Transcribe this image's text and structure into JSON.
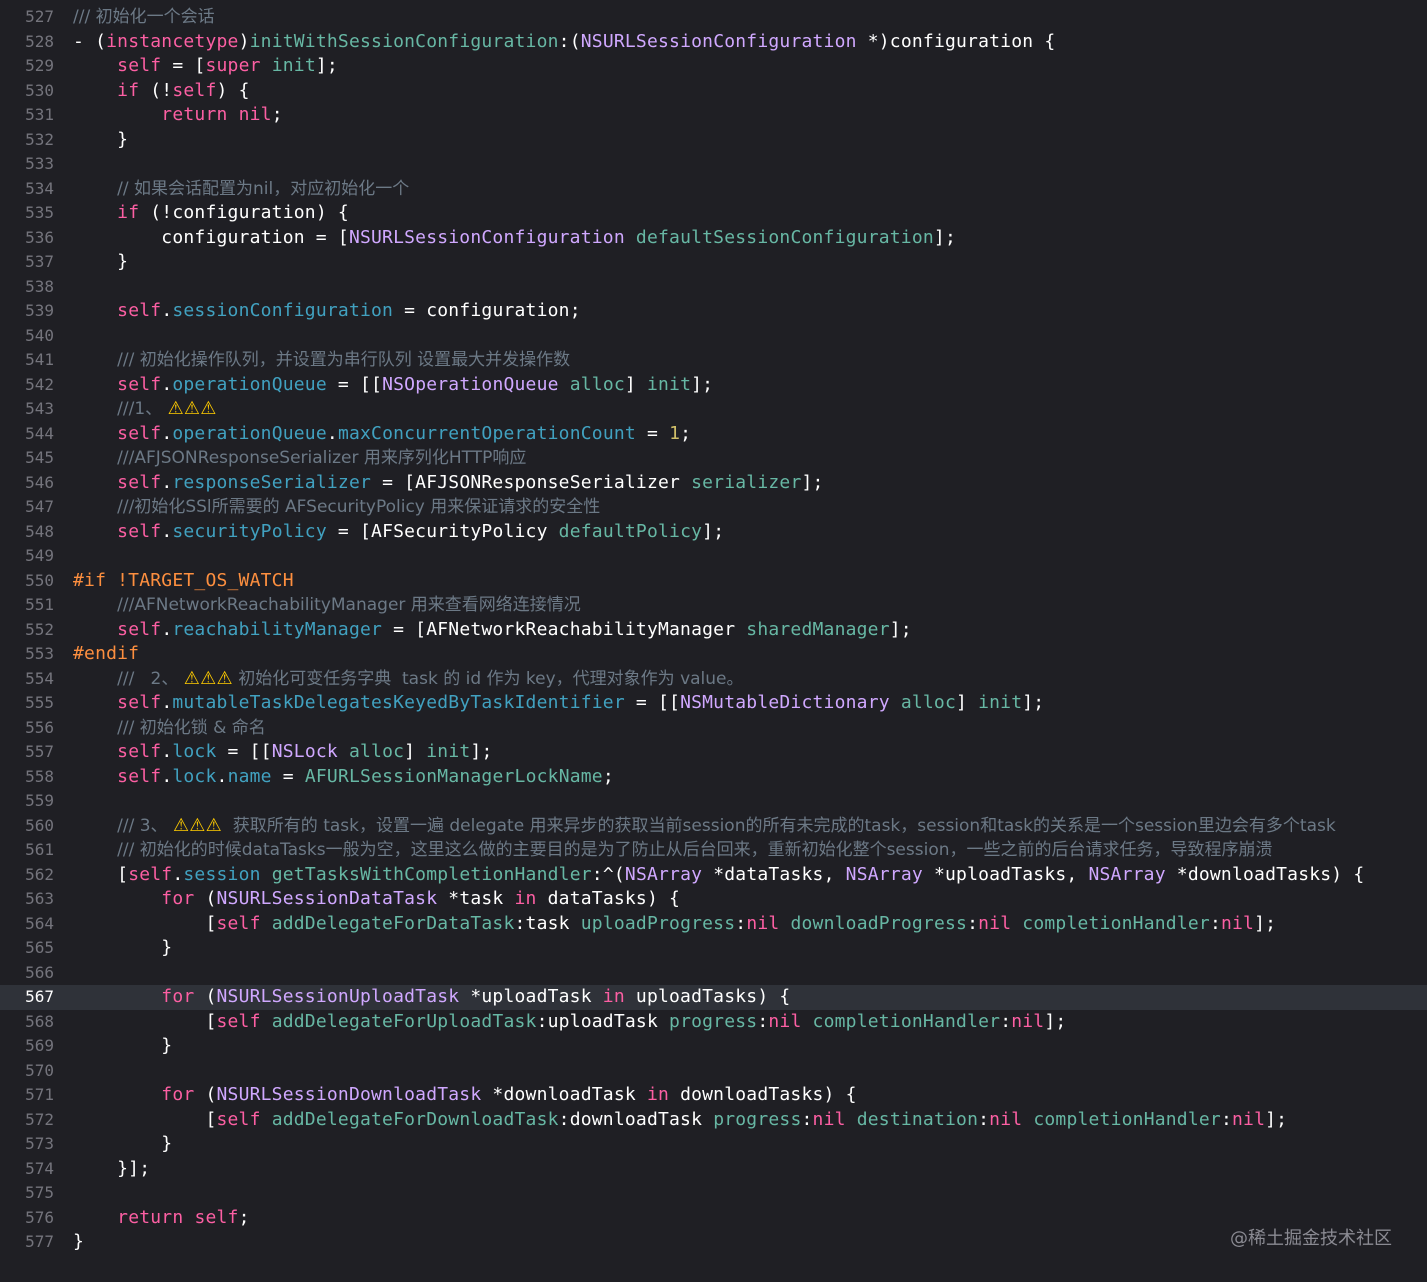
{
  "editor": {
    "current_line": 567,
    "lines": [
      {
        "n": 527,
        "t": [
          [
            "c",
            "/// 初始化一个会话"
          ]
        ]
      },
      {
        "n": 528,
        "t": [
          [
            "p",
            "- ("
          ],
          [
            "k",
            "instancetype"
          ],
          [
            "p",
            ")"
          ],
          [
            "m",
            "initWithSessionConfiguration"
          ],
          [
            "p",
            ":("
          ],
          [
            "t",
            "NSURLSessionConfiguration"
          ],
          [
            "p",
            " *)configuration {"
          ]
        ]
      },
      {
        "n": 529,
        "t": [
          [
            "p",
            "    "
          ],
          [
            "k",
            "self"
          ],
          [
            "p",
            " = ["
          ],
          [
            "k",
            "super"
          ],
          [
            "p",
            " "
          ],
          [
            "m",
            "init"
          ],
          [
            "p",
            "];"
          ]
        ]
      },
      {
        "n": 530,
        "t": [
          [
            "p",
            "    "
          ],
          [
            "k",
            "if"
          ],
          [
            "p",
            " (!"
          ],
          [
            "k",
            "self"
          ],
          [
            "p",
            ") {"
          ]
        ]
      },
      {
        "n": 531,
        "t": [
          [
            "p",
            "        "
          ],
          [
            "k",
            "return"
          ],
          [
            "p",
            " "
          ],
          [
            "k",
            "nil"
          ],
          [
            "p",
            ";"
          ]
        ]
      },
      {
        "n": 532,
        "t": [
          [
            "p",
            "    }"
          ]
        ]
      },
      {
        "n": 533,
        "t": []
      },
      {
        "n": 534,
        "t": [
          [
            "p",
            "    "
          ],
          [
            "c",
            "// 如果会话配置为nil，对应初始化一个"
          ]
        ]
      },
      {
        "n": 535,
        "t": [
          [
            "p",
            "    "
          ],
          [
            "k",
            "if"
          ],
          [
            "p",
            " (!configuration) {"
          ]
        ]
      },
      {
        "n": 536,
        "t": [
          [
            "p",
            "        configuration = ["
          ],
          [
            "t",
            "NSURLSessionConfiguration"
          ],
          [
            "p",
            " "
          ],
          [
            "m",
            "defaultSessionConfiguration"
          ],
          [
            "p",
            "];"
          ]
        ]
      },
      {
        "n": 537,
        "t": [
          [
            "p",
            "    }"
          ]
        ]
      },
      {
        "n": 538,
        "t": []
      },
      {
        "n": 539,
        "t": [
          [
            "p",
            "    "
          ],
          [
            "k",
            "self"
          ],
          [
            "p",
            "."
          ],
          [
            "r",
            "sessionConfiguration"
          ],
          [
            "p",
            " = configuration;"
          ]
        ]
      },
      {
        "n": 540,
        "t": []
      },
      {
        "n": 541,
        "t": [
          [
            "p",
            "    "
          ],
          [
            "c",
            "/// 初始化操作队列，并设置为串行队列 设置最大并发操作数"
          ]
        ]
      },
      {
        "n": 542,
        "t": [
          [
            "p",
            "    "
          ],
          [
            "k",
            "self"
          ],
          [
            "p",
            "."
          ],
          [
            "r",
            "operationQueue"
          ],
          [
            "p",
            " = [["
          ],
          [
            "t",
            "NSOperationQueue"
          ],
          [
            "p",
            " "
          ],
          [
            "m",
            "alloc"
          ],
          [
            "p",
            "] "
          ],
          [
            "m",
            "init"
          ],
          [
            "p",
            "];"
          ]
        ]
      },
      {
        "n": 543,
        "t": [
          [
            "p",
            "    "
          ],
          [
            "c",
            "///1、 "
          ],
          [
            "w",
            "⚠⚠⚠"
          ]
        ]
      },
      {
        "n": 544,
        "t": [
          [
            "p",
            "    "
          ],
          [
            "k",
            "self"
          ],
          [
            "p",
            "."
          ],
          [
            "r",
            "operationQueue"
          ],
          [
            "p",
            "."
          ],
          [
            "r",
            "maxConcurrentOperationCount"
          ],
          [
            "p",
            " = "
          ],
          [
            "n",
            "1"
          ],
          [
            "p",
            ";"
          ]
        ]
      },
      {
        "n": 545,
        "t": [
          [
            "p",
            "    "
          ],
          [
            "c",
            "///AFJSONResponseSerializer 用来序列化HTTP响应"
          ]
        ]
      },
      {
        "n": 546,
        "t": [
          [
            "p",
            "    "
          ],
          [
            "k",
            "self"
          ],
          [
            "p",
            "."
          ],
          [
            "r",
            "responseSerializer"
          ],
          [
            "p",
            " = [AFJSONResponseSerializer "
          ],
          [
            "m",
            "serializer"
          ],
          [
            "p",
            "];"
          ]
        ]
      },
      {
        "n": 547,
        "t": [
          [
            "p",
            "    "
          ],
          [
            "c",
            "///初始化SSl所需要的 AFSecurityPolicy 用来保证请求的安全性"
          ]
        ]
      },
      {
        "n": 548,
        "t": [
          [
            "p",
            "    "
          ],
          [
            "k",
            "self"
          ],
          [
            "p",
            "."
          ],
          [
            "r",
            "securityPolicy"
          ],
          [
            "p",
            " = [AFSecurityPolicy "
          ],
          [
            "m",
            "defaultPolicy"
          ],
          [
            "p",
            "];"
          ]
        ]
      },
      {
        "n": 549,
        "t": []
      },
      {
        "n": 550,
        "t": [
          [
            "x",
            "#if !TARGET_OS_WATCH"
          ]
        ]
      },
      {
        "n": 551,
        "t": [
          [
            "p",
            "    "
          ],
          [
            "c",
            "///AFNetworkReachabilityManager 用来查看网络连接情况"
          ]
        ]
      },
      {
        "n": 552,
        "t": [
          [
            "p",
            "    "
          ],
          [
            "k",
            "self"
          ],
          [
            "p",
            "."
          ],
          [
            "r",
            "reachabilityManager"
          ],
          [
            "p",
            " = [AFNetworkReachabilityManager "
          ],
          [
            "m",
            "sharedManager"
          ],
          [
            "p",
            "];"
          ]
        ]
      },
      {
        "n": 553,
        "t": [
          [
            "x",
            "#endif"
          ]
        ]
      },
      {
        "n": 554,
        "t": [
          [
            "p",
            "    "
          ],
          [
            "c",
            "///   2、 "
          ],
          [
            "w",
            "⚠⚠⚠"
          ],
          [
            "c",
            " 初始化可变任务字典  task 的 id 作为 key，代理对象作为 value。"
          ]
        ]
      },
      {
        "n": 555,
        "t": [
          [
            "p",
            "    "
          ],
          [
            "k",
            "self"
          ],
          [
            "p",
            "."
          ],
          [
            "r",
            "mutableTaskDelegatesKeyedByTaskIdentifier"
          ],
          [
            "p",
            " = [["
          ],
          [
            "t",
            "NSMutableDictionary"
          ],
          [
            "p",
            " "
          ],
          [
            "m",
            "alloc"
          ],
          [
            "p",
            "] "
          ],
          [
            "m",
            "init"
          ],
          [
            "p",
            "];"
          ]
        ]
      },
      {
        "n": 556,
        "t": [
          [
            "p",
            "    "
          ],
          [
            "c",
            "/// 初始化锁 & 命名"
          ]
        ]
      },
      {
        "n": 557,
        "t": [
          [
            "p",
            "    "
          ],
          [
            "k",
            "self"
          ],
          [
            "p",
            "."
          ],
          [
            "r",
            "lock"
          ],
          [
            "p",
            " = [["
          ],
          [
            "t",
            "NSLock"
          ],
          [
            "p",
            " "
          ],
          [
            "m",
            "alloc"
          ],
          [
            "p",
            "] "
          ],
          [
            "m",
            "init"
          ],
          [
            "p",
            "];"
          ]
        ]
      },
      {
        "n": 558,
        "t": [
          [
            "p",
            "    "
          ],
          [
            "k",
            "self"
          ],
          [
            "p",
            "."
          ],
          [
            "r",
            "lock"
          ],
          [
            "p",
            "."
          ],
          [
            "r",
            "name"
          ],
          [
            "p",
            " = "
          ],
          [
            "m",
            "AFURLSessionManagerLockName"
          ],
          [
            "p",
            ";"
          ]
        ]
      },
      {
        "n": 559,
        "t": []
      },
      {
        "n": 560,
        "t": [
          [
            "p",
            "    "
          ],
          [
            "c",
            "/// 3、 "
          ],
          [
            "w",
            "⚠⚠⚠"
          ],
          [
            "c",
            "  获取所有的 task，设置一遍 delegate 用来异步的获取当前session的所有未完成的task，session和task的关系是一个session里边会有多个task"
          ]
        ]
      },
      {
        "n": 561,
        "t": [
          [
            "p",
            "    "
          ],
          [
            "c",
            "/// 初始化的时候dataTasks一般为空，这里这么做的主要目的是为了防止从后台回来，重新初始化整个session，一些之前的后台请求任务，导致程序崩溃"
          ]
        ]
      },
      {
        "n": 562,
        "t": [
          [
            "p",
            "    ["
          ],
          [
            "k",
            "self"
          ],
          [
            "p",
            "."
          ],
          [
            "r",
            "session"
          ],
          [
            "p",
            " "
          ],
          [
            "m",
            "getTasksWithCompletionHandler"
          ],
          [
            "p",
            ":^("
          ],
          [
            "t",
            "NSArray"
          ],
          [
            "p",
            " *dataTasks, "
          ],
          [
            "t",
            "NSArray"
          ],
          [
            "p",
            " *uploadTasks, "
          ],
          [
            "t",
            "NSArray"
          ],
          [
            "p",
            " *downloadTasks) {"
          ]
        ]
      },
      {
        "n": 563,
        "t": [
          [
            "p",
            "        "
          ],
          [
            "k",
            "for"
          ],
          [
            "p",
            " ("
          ],
          [
            "t",
            "NSURLSessionDataTask"
          ],
          [
            "p",
            " *task "
          ],
          [
            "k",
            "in"
          ],
          [
            "p",
            " dataTasks) {"
          ]
        ]
      },
      {
        "n": 564,
        "t": [
          [
            "p",
            "            ["
          ],
          [
            "k",
            "self"
          ],
          [
            "p",
            " "
          ],
          [
            "m",
            "addDelegateForDataTask"
          ],
          [
            "p",
            ":task "
          ],
          [
            "m",
            "uploadProgress"
          ],
          [
            "p",
            ":"
          ],
          [
            "k",
            "nil"
          ],
          [
            "p",
            " "
          ],
          [
            "m",
            "downloadProgress"
          ],
          [
            "p",
            ":"
          ],
          [
            "k",
            "nil"
          ],
          [
            "p",
            " "
          ],
          [
            "m",
            "completionHandler"
          ],
          [
            "p",
            ":"
          ],
          [
            "k",
            "nil"
          ],
          [
            "p",
            "];"
          ]
        ]
      },
      {
        "n": 565,
        "t": [
          [
            "p",
            "        }"
          ]
        ]
      },
      {
        "n": 566,
        "t": []
      },
      {
        "n": 567,
        "t": [
          [
            "p",
            "        "
          ],
          [
            "k",
            "for"
          ],
          [
            "p",
            " ("
          ],
          [
            "t",
            "NSURLSessionUploadTask"
          ],
          [
            "p",
            " *uploadTask "
          ],
          [
            "k",
            "in"
          ],
          [
            "p",
            " uploadTasks) {"
          ]
        ]
      },
      {
        "n": 568,
        "t": [
          [
            "p",
            "            ["
          ],
          [
            "k",
            "self"
          ],
          [
            "p",
            " "
          ],
          [
            "m",
            "addDelegateForUploadTask"
          ],
          [
            "p",
            ":uploadTask "
          ],
          [
            "m",
            "progress"
          ],
          [
            "p",
            ":"
          ],
          [
            "k",
            "nil"
          ],
          [
            "p",
            " "
          ],
          [
            "m",
            "completionHandler"
          ],
          [
            "p",
            ":"
          ],
          [
            "k",
            "nil"
          ],
          [
            "p",
            "];"
          ]
        ]
      },
      {
        "n": 569,
        "t": [
          [
            "p",
            "        }"
          ]
        ]
      },
      {
        "n": 570,
        "t": []
      },
      {
        "n": 571,
        "t": [
          [
            "p",
            "        "
          ],
          [
            "k",
            "for"
          ],
          [
            "p",
            " ("
          ],
          [
            "t",
            "NSURLSessionDownloadTask"
          ],
          [
            "p",
            " *downloadTask "
          ],
          [
            "k",
            "in"
          ],
          [
            "p",
            " downloadTasks) {"
          ]
        ]
      },
      {
        "n": 572,
        "t": [
          [
            "p",
            "            ["
          ],
          [
            "k",
            "self"
          ],
          [
            "p",
            " "
          ],
          [
            "m",
            "addDelegateForDownloadTask"
          ],
          [
            "p",
            ":downloadTask "
          ],
          [
            "m",
            "progress"
          ],
          [
            "p",
            ":"
          ],
          [
            "k",
            "nil"
          ],
          [
            "p",
            " "
          ],
          [
            "m",
            "destination"
          ],
          [
            "p",
            ":"
          ],
          [
            "k",
            "nil"
          ],
          [
            "p",
            " "
          ],
          [
            "m",
            "completionHandler"
          ],
          [
            "p",
            ":"
          ],
          [
            "k",
            "nil"
          ],
          [
            "p",
            "];"
          ]
        ]
      },
      {
        "n": 573,
        "t": [
          [
            "p",
            "        }"
          ]
        ]
      },
      {
        "n": 574,
        "t": [
          [
            "p",
            "    }];"
          ]
        ]
      },
      {
        "n": 575,
        "t": []
      },
      {
        "n": 576,
        "t": [
          [
            "p",
            "    "
          ],
          [
            "k",
            "return"
          ],
          [
            "p",
            " "
          ],
          [
            "k",
            "self"
          ],
          [
            "p",
            ";"
          ]
        ]
      },
      {
        "n": 577,
        "t": [
          [
            "p",
            "}"
          ]
        ]
      }
    ]
  },
  "watermark": "@稀土掘金技术社区",
  "colors": {
    "background": "#1f1f24",
    "current_line": "#2f3239",
    "comment": "#6c7986",
    "keyword": "#fc5fa3",
    "type": "#d0a8ff",
    "method": "#67b7a4",
    "property": "#41a1c0",
    "number": "#d0bf69",
    "preprocessor": "#fd8f3f",
    "warning": "#ffcc00"
  }
}
